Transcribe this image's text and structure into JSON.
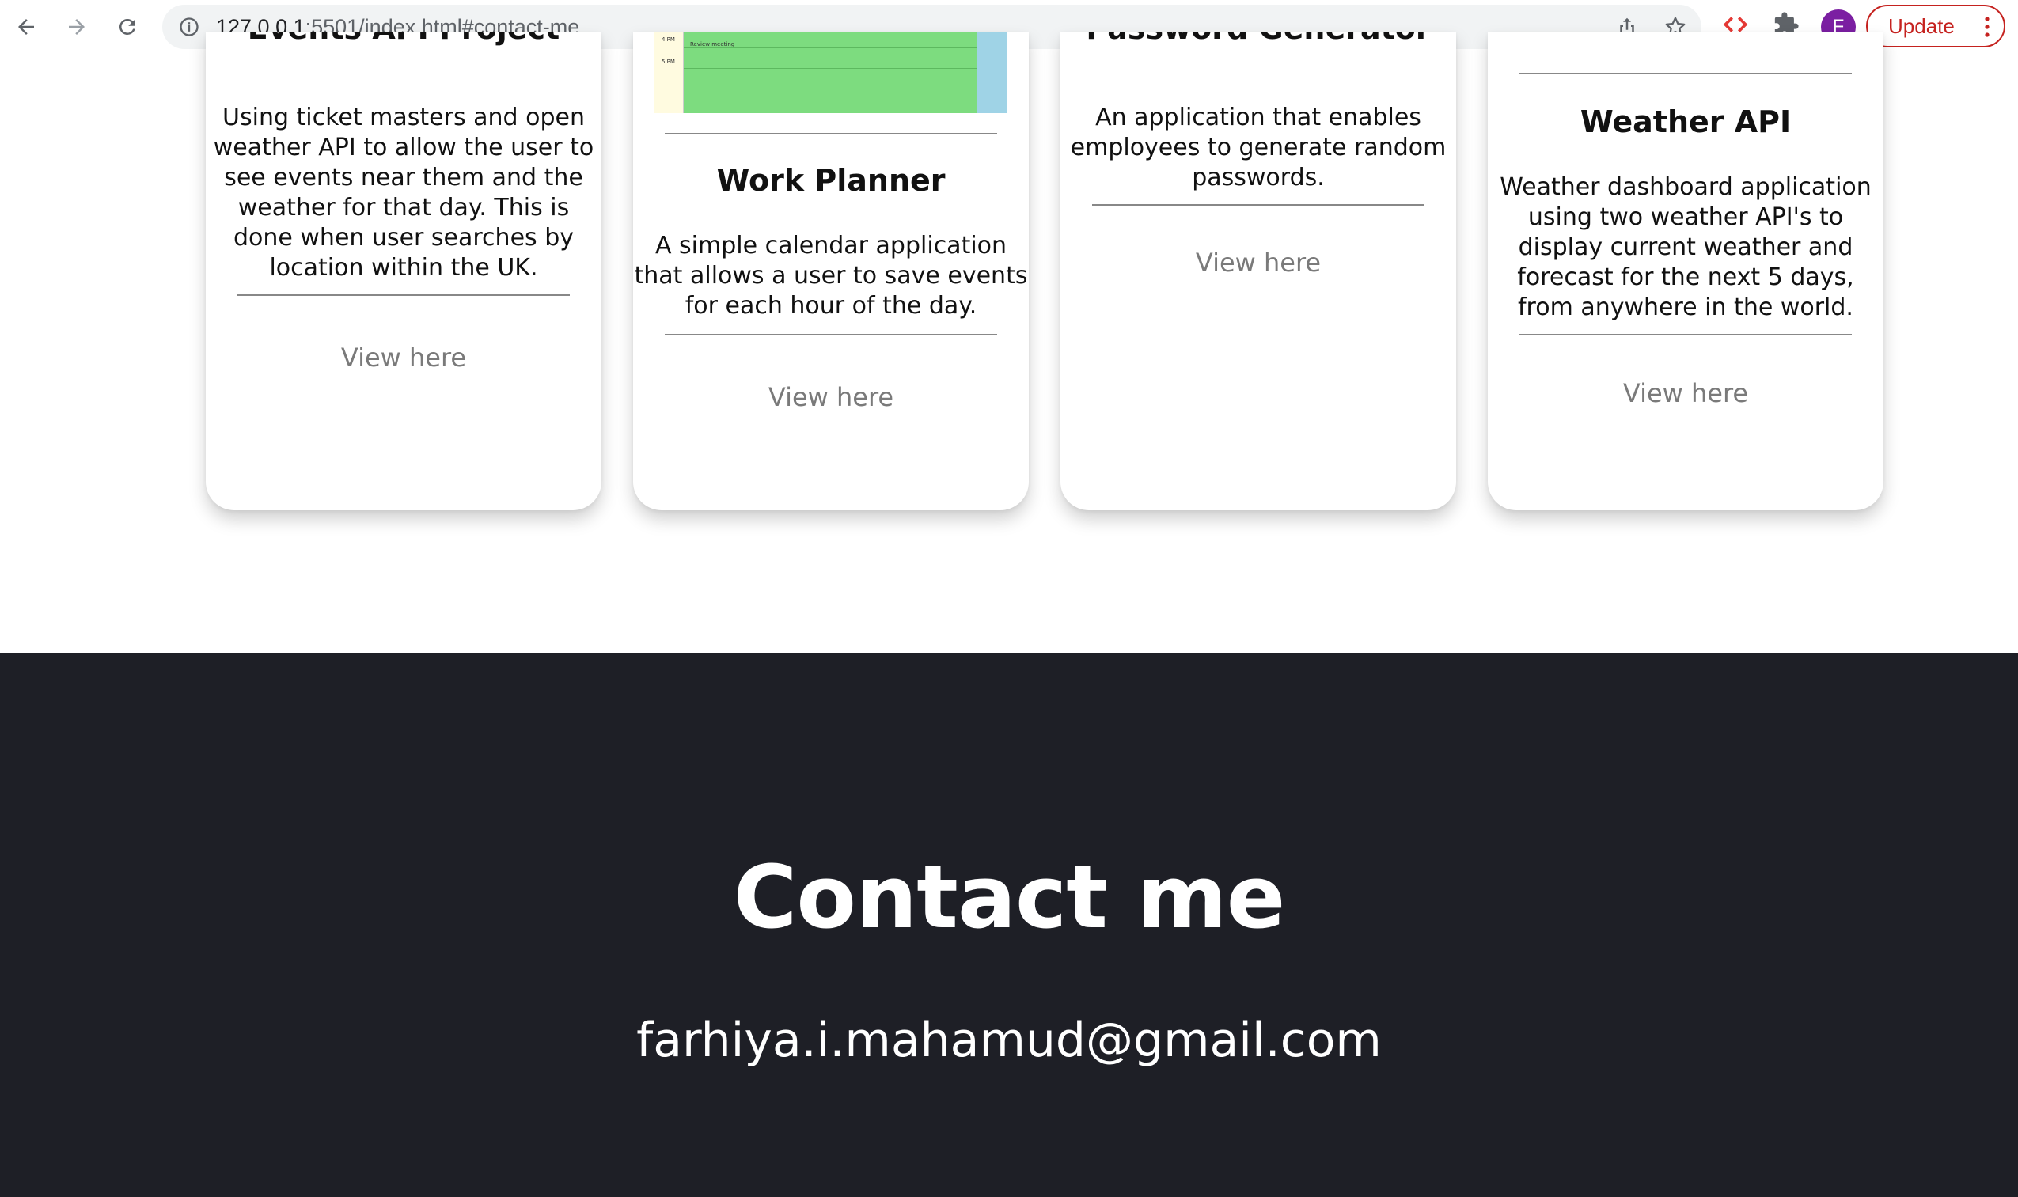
{
  "browser": {
    "url_host": "127.0.0.1",
    "url_rest": ":5501/index.html#contact-me",
    "profile_initial": "F",
    "update_label": "Update",
    "icons": [
      "back-icon",
      "forward-icon",
      "reload-icon",
      "info-icon",
      "share-icon",
      "bookmark-star-icon",
      "code-extension-icon",
      "puzzle-extensions-icon",
      "more-vert-icon"
    ]
  },
  "projects": [
    {
      "title": "Events API Project",
      "description": "Using ticket masters and open weather API to allow the user to see events near them and the weather for that day. This is done when user searches by location within the UK.",
      "link": "View here"
    },
    {
      "title": "Work Planner",
      "thumb_labels": [
        "4 PM",
        "Review meeting",
        "5 PM"
      ],
      "description": "A simple calendar application that allows a user to save events for each hour of the day.",
      "link": "View here"
    },
    {
      "title": "Password Generator",
      "description": "An application that enables employees to generate random passwords.",
      "link": "View here"
    },
    {
      "title": "Weather API",
      "description": "Weather dashboard application using two weather API's to display current weather and forecast for the next 5 days, from anywhere in the world.",
      "link": "View here"
    }
  ],
  "contact": {
    "title": "Contact me",
    "email": "farhiya.i.mahamud@gmail.com"
  },
  "colors": {
    "contact_bg": "#1e1f26",
    "update_red": "#c5221f",
    "avatar_purple": "#7b1fa2",
    "planner_green": "#7ddc7f",
    "planner_blue": "#9fd3e6"
  }
}
